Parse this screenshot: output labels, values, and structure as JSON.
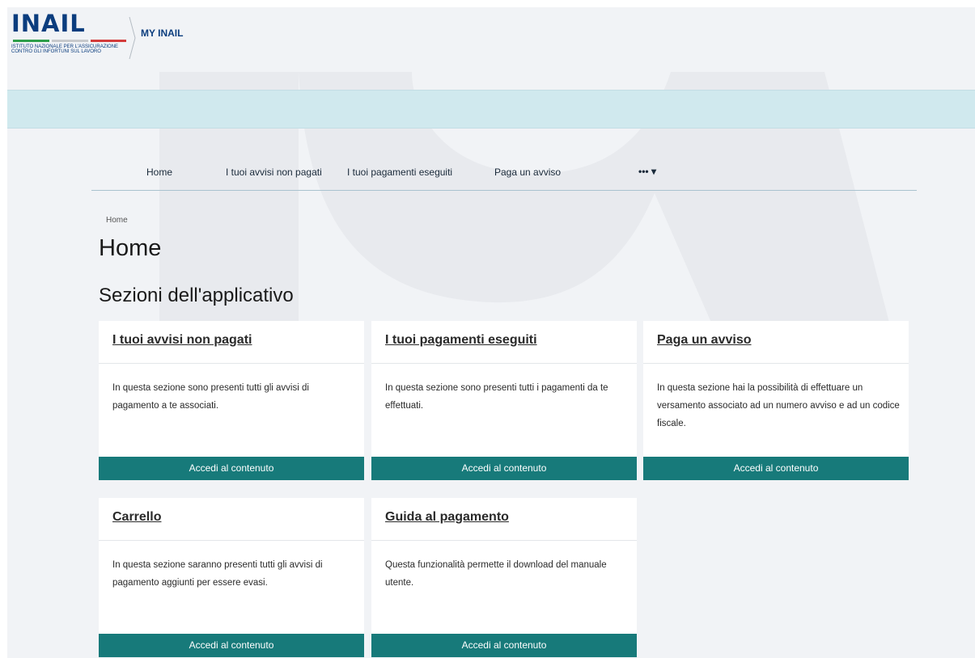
{
  "header": {
    "logo_text": "INAIL",
    "logo_subtitle": "ISTITUTO NAZIONALE PER L'ASSICURAZIONE\nCONTRO GLI INFORTUNI SUL LAVORO",
    "app_name": "MY INAIL"
  },
  "nav": {
    "items": [
      {
        "label": "Home"
      },
      {
        "label": "I tuoi avvisi non pagati"
      },
      {
        "label": "I tuoi pagamenti eseguiti"
      },
      {
        "label": "Paga un avviso"
      }
    ],
    "more_label": "••• ▾"
  },
  "breadcrumb": "Home",
  "page_title": "Home",
  "section_title": "Sezioni dell'applicativo",
  "cards": [
    {
      "title": "I tuoi avvisi non pagati",
      "description": "In questa sezione sono presenti tutti gli avvisi di pagamento a te associati.",
      "button": "Accedi al contenuto"
    },
    {
      "title": "I tuoi pagamenti eseguiti",
      "description": "In questa sezione sono presenti tutti i pagamenti da te effettuati.",
      "button": "Accedi al contenuto"
    },
    {
      "title": "Paga un avviso",
      "description": "In questa sezione hai la possibilità di effettuare un versamento associato ad un numero avviso e ad un codice fiscale.",
      "button": "Accedi al contenuto"
    },
    {
      "title": "Carrello",
      "description": "In questa sezione saranno presenti tutti gli avvisi di pagamento aggiunti per essere evasi.",
      "button": "Accedi al contenuto"
    },
    {
      "title": "Guida al pagamento",
      "description": "Questa funzionalità permette il download del manuale utente.",
      "button": "Accedi al contenuto"
    }
  ],
  "colors": {
    "brand_blue": "#0b3d7e",
    "accent_teal": "#177a7a",
    "banner": "#d0e9ee",
    "background": "#f1f3f6"
  }
}
